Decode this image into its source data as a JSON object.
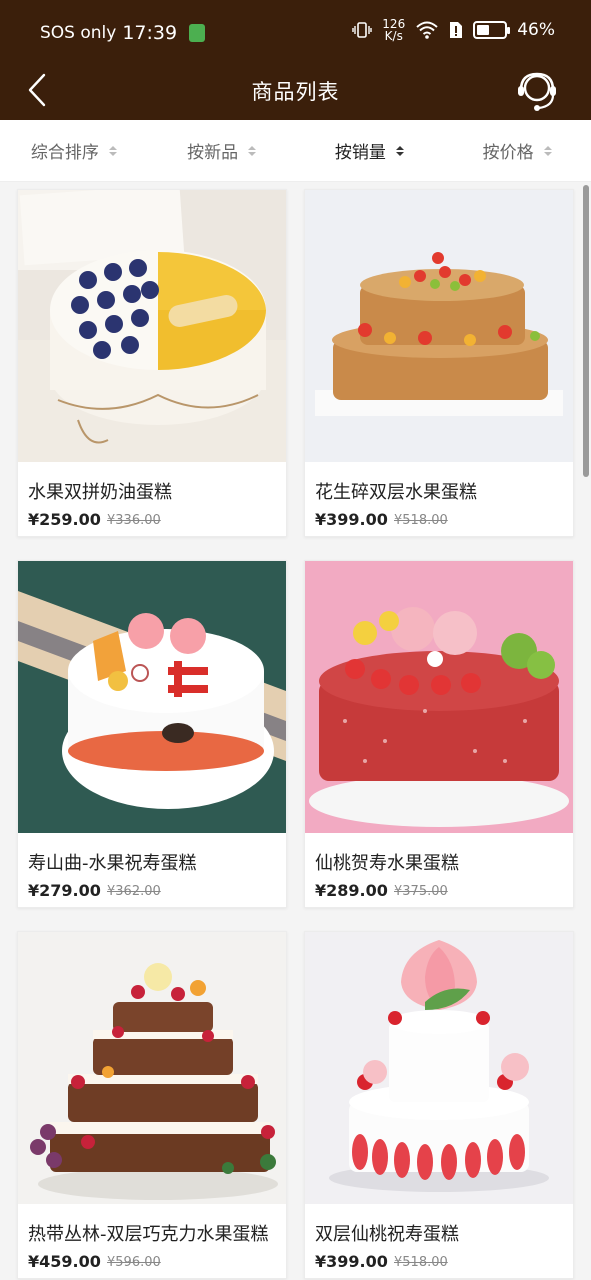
{
  "status_bar": {
    "carrier": "SOS only",
    "time": "17:39",
    "net_speed_value": "126",
    "net_speed_unit": "K/s",
    "battery_percent": "46%",
    "battery_level": 0.46
  },
  "header": {
    "title": "商品列表",
    "back_icon": "chevron-left-icon",
    "service_icon": "customer-service-headset-icon"
  },
  "sort_bar": {
    "items": [
      {
        "label": "综合排序",
        "active": false
      },
      {
        "label": "按新品",
        "active": false
      },
      {
        "label": "按销量",
        "active": true
      },
      {
        "label": "按价格",
        "active": false
      }
    ]
  },
  "products": [
    {
      "name": "水果双拼奶油蛋糕",
      "price": "¥259.00",
      "original_price": "¥336.00"
    },
    {
      "name": "花生碎双层水果蛋糕",
      "price": "¥399.00",
      "original_price": "¥518.00"
    },
    {
      "name": "寿山曲-水果祝寿蛋糕",
      "price": "¥279.00",
      "original_price": "¥362.00"
    },
    {
      "name": "仙桃贺寿水果蛋糕",
      "price": "¥289.00",
      "original_price": "¥375.00"
    },
    {
      "name": "热带丛林-双层巧克力水果蛋糕",
      "price": "¥459.00",
      "original_price": "¥596.00"
    },
    {
      "name": "双层仙桃祝寿蛋糕",
      "price": "¥399.00",
      "original_price": "¥518.00"
    }
  ],
  "colors": {
    "header_bg": "#3b1f0b",
    "text_primary": "#222222",
    "text_secondary": "#666666"
  }
}
